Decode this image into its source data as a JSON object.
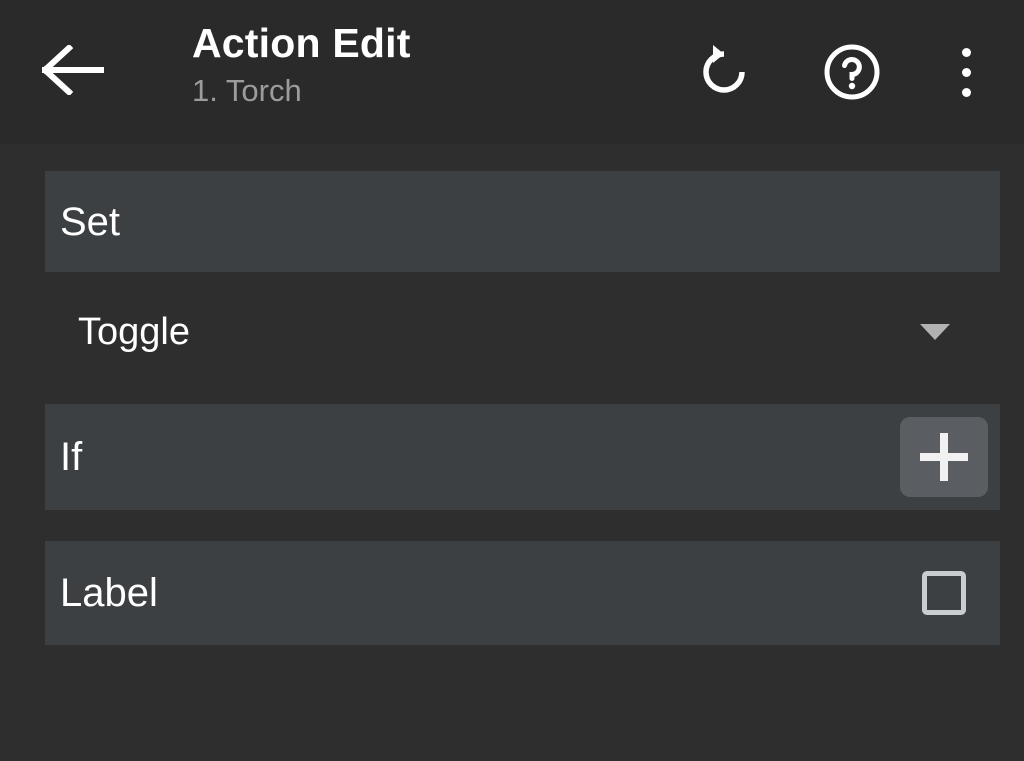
{
  "window": {
    "title": "Action Edit",
    "subtitle": "1. Torch"
  },
  "toolbar": {
    "back_icon": "back-arrow-icon",
    "undo_icon": "undo-icon",
    "help_icon": "help-circle-icon",
    "overflow_icon": "more-vertical-icon"
  },
  "colors": {
    "page_background": "#2e2e2e",
    "toolbar_background": "#2a2a2a",
    "card_background": "#3c4043",
    "button_background": "#5a5d61",
    "primary_text": "#ffffff",
    "secondary_text": "#9c9c9c",
    "caret": "#b2b2b2",
    "checkbox_border": "#c8cdd1"
  },
  "main": {
    "rows": [
      {
        "label": "Set"
      },
      {
        "label": "If",
        "action_label": "+",
        "action_icon": "plus-icon"
      },
      {
        "label": "Label",
        "checkbox_checked": false,
        "checkbox_icon": "checkbox-unchecked-icon"
      }
    ],
    "set_dropdown": {
      "value": "Toggle",
      "caret_icon": "chevron-down-icon"
    }
  }
}
